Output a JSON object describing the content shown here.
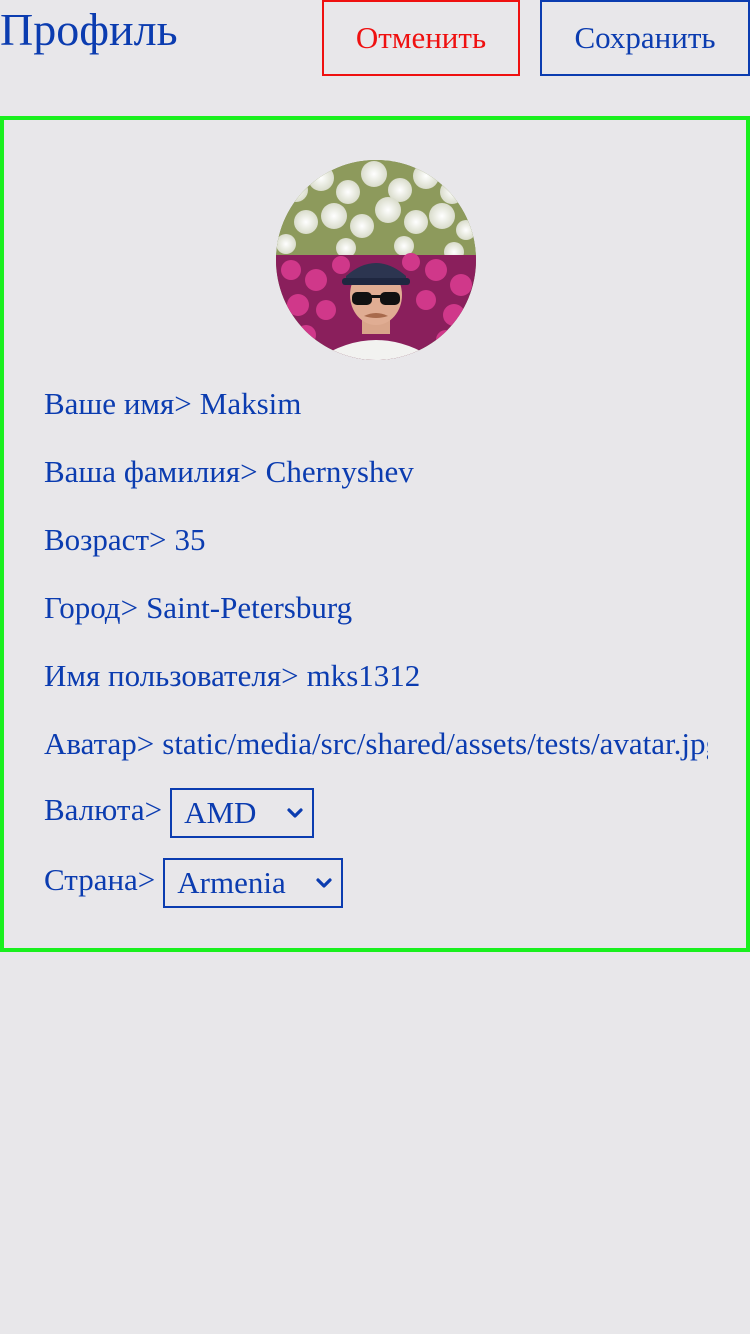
{
  "header": {
    "title": "Профиль",
    "cancel_label": "Отменить",
    "save_label": "Сохранить"
  },
  "profile": {
    "first_name": {
      "label": "Ваше имя>",
      "value": "Maksim"
    },
    "last_name": {
      "label": "Ваша фамилия>",
      "value": "Chernyshev"
    },
    "age": {
      "label": "Возраст>",
      "value": "35"
    },
    "city": {
      "label": "Город>",
      "value": "Saint-Petersburg"
    },
    "username": {
      "label": "Имя пользователя>",
      "value": "mks1312"
    },
    "avatar": {
      "label": "Аватар>",
      "value": "static/media/src/shared/assets/tests/avatar.jpg"
    },
    "currency": {
      "label": "Валюта>",
      "selected": "AMD"
    },
    "country": {
      "label": "Страна>",
      "selected": "Armenia"
    }
  },
  "colors": {
    "primary": "#0b3cb0",
    "danger": "#ef1010",
    "card_border": "#19f01e",
    "background": "#e8e7ea"
  },
  "icons": {
    "select_chevron": "chevron-down-icon"
  }
}
